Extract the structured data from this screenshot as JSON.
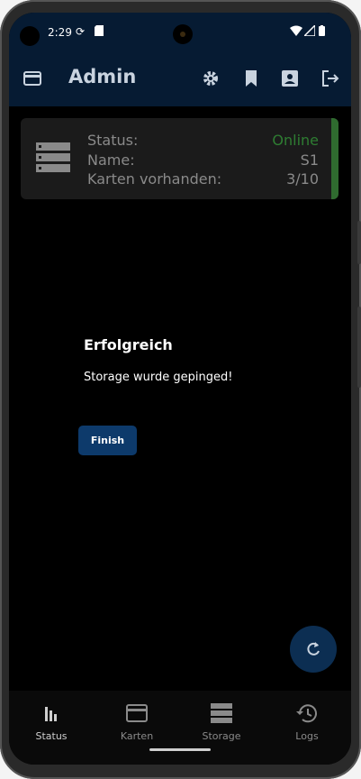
{
  "status_bar": {
    "time": "2:29"
  },
  "app_bar": {
    "title": "Admin"
  },
  "storage_card": {
    "rows": [
      {
        "label": "Status:",
        "value": "Online"
      },
      {
        "label": "Name:",
        "value": "S1"
      },
      {
        "label": "Karten vorhanden:",
        "value": "3/10"
      }
    ]
  },
  "dialog": {
    "title": "Erfolgreich",
    "message": "Storage wurde gepinged!",
    "button_label": "Finish"
  },
  "bottom_nav": {
    "items": [
      {
        "label": "Status",
        "icon": "bar-chart-icon"
      },
      {
        "label": "Karten",
        "icon": "card-icon"
      },
      {
        "label": "Storage",
        "icon": "storage-icon"
      },
      {
        "label": "Logs",
        "icon": "history-icon"
      }
    ]
  },
  "colors": {
    "appbar": "#061b33",
    "online": "#2e7d32",
    "button": "#0d3a6b",
    "fab": "#0c2e52"
  }
}
